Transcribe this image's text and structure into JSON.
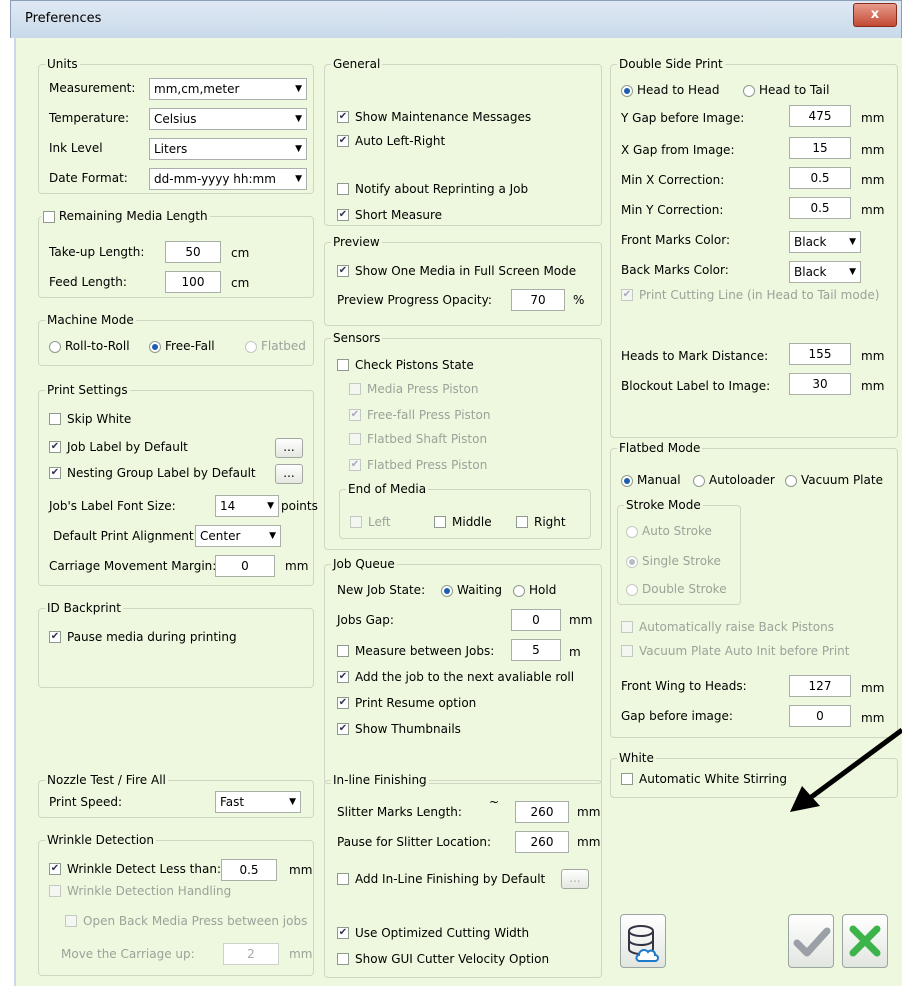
{
  "window": {
    "title": "Preferences",
    "close": "x"
  },
  "units": {
    "title": "Units",
    "measurement_label": "Measurement:",
    "measurement_value": "mm,cm,meter",
    "temperature_label": "Temperature:",
    "temperature_value": "Celsius",
    "ink_label": "Ink Level",
    "ink_value": "Liters",
    "date_label": "Date Format:",
    "date_value": "dd-mm-yyyy hh:mm"
  },
  "remaining": {
    "title": "Remaining Media Length",
    "takeup_label": "Take-up Length:",
    "takeup_value": "50",
    "takeup_unit": "cm",
    "feed_label": "Feed Length:",
    "feed_value": "100",
    "feed_unit": "cm"
  },
  "machine": {
    "title": "Machine Mode",
    "roll": "Roll-to-Roll",
    "free": "Free-Fall",
    "flat": "Flatbed"
  },
  "print_settings": {
    "title": "Print Settings",
    "skip_white": "Skip White",
    "job_label": "Job Label by Default",
    "nesting_label": "Nesting Group Label by Default",
    "font_size_label": "Job's Label Font Size:",
    "font_size_value": "14",
    "font_size_unit": "points",
    "align_label": "Default Print Alignment:",
    "align_value": "Center",
    "margin_label": "Carriage Movement Margin:",
    "margin_value": "0",
    "margin_unit": "mm",
    "ellipsis": "..."
  },
  "id_backprint": {
    "title": "ID Backprint",
    "pause": "Pause media during printing"
  },
  "nozzle": {
    "title": "Nozzle Test / Fire All",
    "speed_label": "Print Speed:",
    "speed_value": "Fast"
  },
  "wrinkle": {
    "title": "Wrinkle Detection",
    "detect": "Wrinkle Detect Less than:",
    "detect_value": "0.5",
    "detect_unit": "mm",
    "handling": "Wrinkle Detection Handling",
    "open_back": "Open Back Media Press between jobs",
    "move_label": "Move the Carriage up:",
    "move_value": "2",
    "move_unit": "mm"
  },
  "general": {
    "title": "General",
    "maintenance": "Show Maintenance Messages",
    "auto_lr": "Auto Left-Right",
    "notify": "Notify about Reprinting a Job",
    "short": "Short Measure"
  },
  "preview": {
    "title": "Preview",
    "one_media": "Show One Media in Full Screen Mode",
    "opacity_label": "Preview Progress Opacity:",
    "opacity_value": "70",
    "opacity_unit": "%"
  },
  "sensors": {
    "title": "Sensors",
    "check": "Check Pistons State",
    "media_press": "Media Press Piston",
    "freefall": "Free-fall Press Piston",
    "flatbed_shaft": "Flatbed Shaft Piston",
    "flatbed_press": "Flatbed Press Piston",
    "eom_title": "End of Media",
    "left": "Left",
    "middle": "Middle",
    "right": "Right"
  },
  "job_queue": {
    "title": "Job Queue",
    "state_label": "New Job State:",
    "waiting": "Waiting",
    "hold": "Hold",
    "gap_label": "Jobs Gap:",
    "gap_value": "0",
    "gap_unit": "mm",
    "measure": "Measure between Jobs:",
    "measure_value": "5",
    "measure_unit": "m",
    "add_next": "Add the job to the next avaliable roll",
    "resume": "Print Resume option",
    "thumbs": "Show Thumbnails"
  },
  "inline": {
    "title": "In-line Finishing",
    "slitter_label": "Slitter Marks Length:",
    "tilde": "~",
    "slitter_value": "260",
    "slitter_unit": "mm",
    "pause_label": "Pause for Slitter Location:",
    "pause_value": "260",
    "pause_unit": "mm",
    "add_default": "Add In-Line Finishing by Default",
    "optimized": "Use Optimized Cutting Width",
    "gui_cutter": "Show GUI Cutter Velocity Option"
  },
  "double_side": {
    "title": "Double Side Print",
    "h2h": "Head to Head",
    "h2t": "Head to Tail",
    "ygap_label": "Y Gap before Image:",
    "ygap_value": "475",
    "xgap_label": "X Gap from Image:",
    "xgap_value": "15",
    "minx_label": "Min X Correction:",
    "minx_value": "0.5",
    "miny_label": "Min Y Correction:",
    "miny_value": "0.5",
    "front_label": "Front Marks Color:",
    "front_value": "Black",
    "back_label": "Back Marks Color:",
    "back_value": "Black",
    "cutting": "Print Cutting Line (in Head to Tail mode)",
    "heads_label": "Heads to Mark Distance:",
    "heads_value": "155",
    "blockout_label": "Blockout Label to Image:",
    "blockout_value": "30",
    "unit": "mm"
  },
  "flatbed": {
    "title": "Flatbed Mode",
    "manual": "Manual",
    "autoloader": "Autoloader",
    "vacuum": "Vacuum Plate",
    "stroke_title": "Stroke Mode",
    "auto_stroke": "Auto Stroke",
    "single": "Single Stroke",
    "double": "Double Stroke",
    "raise": "Automatically raise Back Pistons",
    "vac_init": "Vacuum Plate Auto Init before Print",
    "wing_label": "Front Wing to Heads:",
    "wing_value": "127",
    "gap_label": "Gap before image:",
    "gap_value": "0",
    "unit": "mm"
  },
  "white": {
    "title": "White",
    "stirring": "Automatic White Stirring"
  },
  "colors": {
    "bg": "#eef8de",
    "ok": "#9aa0a6",
    "cancel": "#3cb44a",
    "arrow": "#000000"
  }
}
